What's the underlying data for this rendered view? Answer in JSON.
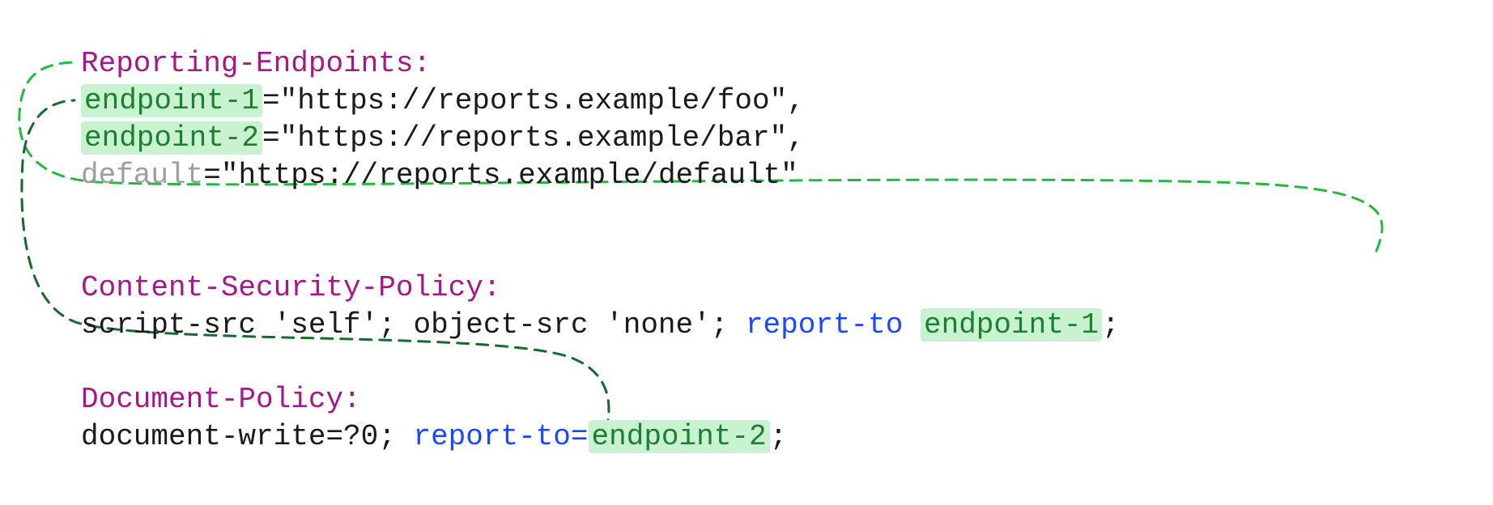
{
  "blocks": {
    "reporting_endpoints": {
      "header": "Reporting-Endpoints:",
      "endpoints": [
        {
          "name": "endpoint-1",
          "url": "https://reports.example/foo",
          "trailing": ",",
          "highlight": true
        },
        {
          "name": "endpoint-2",
          "url": "https://reports.example/bar",
          "trailing": ",",
          "highlight": true
        },
        {
          "name": "default",
          "url": "https://reports.example/default",
          "trailing": "",
          "highlight": false
        }
      ]
    },
    "csp": {
      "header": "Content-Security-Policy:",
      "directives": "script-src 'self'; object-src 'none'; ",
      "report_to_keyword": "report-to",
      "separator": " ",
      "endpoint_ref": "endpoint-1",
      "trailing": ";"
    },
    "doc_policy": {
      "header": "Document-Policy:",
      "directives": "document-write=?0; ",
      "report_to_keyword": "report-to=",
      "separator": "",
      "endpoint_ref": "endpoint-2",
      "trailing": ";"
    }
  },
  "arrows": [
    {
      "from": "csp.endpoint-1",
      "to": "reporting-endpoints.endpoint-1",
      "color": "#23b83e"
    },
    {
      "from": "doc_policy.endpoint-2",
      "to": "reporting-endpoints.endpoint-2",
      "color": "#146b2a"
    }
  ]
}
